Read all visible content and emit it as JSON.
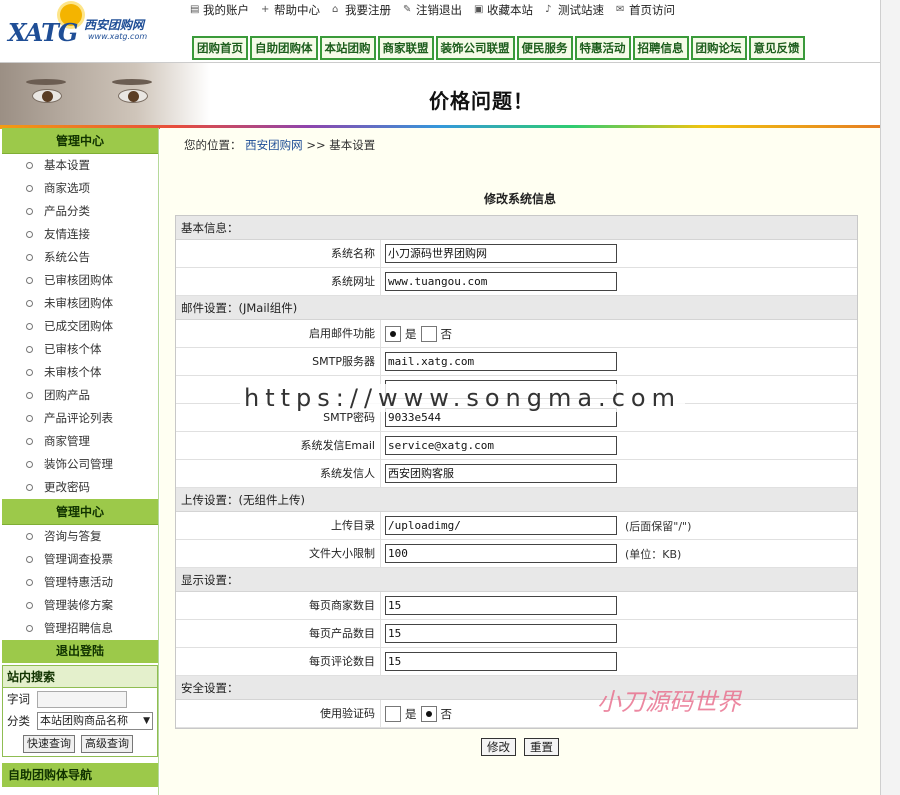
{
  "logo": {
    "brand": "XATG",
    "name_cn": "西安团购网",
    "url": "www.xatg.com"
  },
  "toplinks": [
    {
      "label": "我的账户",
      "icon": "doc-icon"
    },
    {
      "label": "帮助中心",
      "icon": "plus-icon"
    },
    {
      "label": "我要注册",
      "icon": "house-icon"
    },
    {
      "label": "注销退出",
      "icon": "pencil-icon"
    },
    {
      "label": "收藏本站",
      "icon": "folder-icon"
    },
    {
      "label": "测试站速",
      "icon": "music-icon"
    },
    {
      "label": "首页访问",
      "icon": "mail-icon"
    }
  ],
  "mainnav": [
    "团购首页",
    "自助团购体",
    "本站团购",
    "商家联盟",
    "装饰公司联盟",
    "便民服务",
    "特惠活动",
    "招聘信息",
    "团购论坛",
    "意见反馈"
  ],
  "banner": {
    "title": "价格问题！"
  },
  "sidebar": {
    "admin_title": "管理中心",
    "admin_items": [
      "基本设置",
      "商家选项",
      "产品分类",
      "友情连接",
      "系统公告",
      "已审核团购体",
      "未审核团购体",
      "已成交团购体",
      "已审核个体",
      "未审核个体",
      "团购产品",
      "产品评论列表",
      "商家管理",
      "装饰公司管理",
      "更改密码"
    ],
    "admin_title2": "管理中心",
    "admin_items2": [
      "咨询与答复",
      "管理调查投票",
      "管理特惠活动",
      "管理装修方案",
      "管理招聘信息"
    ],
    "logout": "退出登陆",
    "search": {
      "title": "站内搜索",
      "keyword_label": "字词",
      "category_label": "分类",
      "category_value": "本站团购商品名称",
      "quick_btn": "快速查询",
      "advanced_btn": "高级查询"
    },
    "nav_title": "自助团购体导航"
  },
  "breadcrumb": {
    "prefix": "您的位置：",
    "link": "西安团购网",
    "sep": ">>",
    "current": "基本设置"
  },
  "form": {
    "title": "修改系统信息",
    "sections": {
      "basic": "基本信息：",
      "mail": "邮件设置：(JMail组件)",
      "upload": "上传设置：(无组件上传)",
      "display": "显示设置：",
      "security": "安全设置："
    },
    "fields": {
      "sys_name": {
        "label": "系统名称",
        "value": "小刀源码世界团购网"
      },
      "sys_url": {
        "label": "系统网址",
        "value": "www.tuangou.com"
      },
      "mail_enable": {
        "label": "启用邮件功能",
        "yes": "是",
        "no": "否",
        "selected": "yes"
      },
      "smtp_server": {
        "label": "SMTP服务器",
        "value": "mail.xatg.com"
      },
      "smtp_pass": {
        "label": "SMTP密码",
        "value": "9033e544"
      },
      "sys_email": {
        "label": "系统发信Email",
        "value": "service@xatg.com"
      },
      "sender": {
        "label": "系统发信人",
        "value": "西安团购客服"
      },
      "upload_dir": {
        "label": "上传目录",
        "value": "/uploadimg/",
        "hint": "(后面保留\"/\")"
      },
      "file_limit": {
        "label": "文件大小限制",
        "value": "100",
        "hint": "(单位：KB)"
      },
      "per_merchant": {
        "label": "每页商家数目",
        "value": "15"
      },
      "per_product": {
        "label": "每页产品数目",
        "value": "15"
      },
      "per_review": {
        "label": "每页评论数目",
        "value": "15"
      },
      "captcha": {
        "label": "使用验证码",
        "yes": "是",
        "no": "否",
        "selected": "no"
      }
    },
    "submit": "修改",
    "reset": "重置"
  },
  "watermarks": {
    "url": "https://www.songma.com",
    "cn": "小刀源码世界"
  }
}
